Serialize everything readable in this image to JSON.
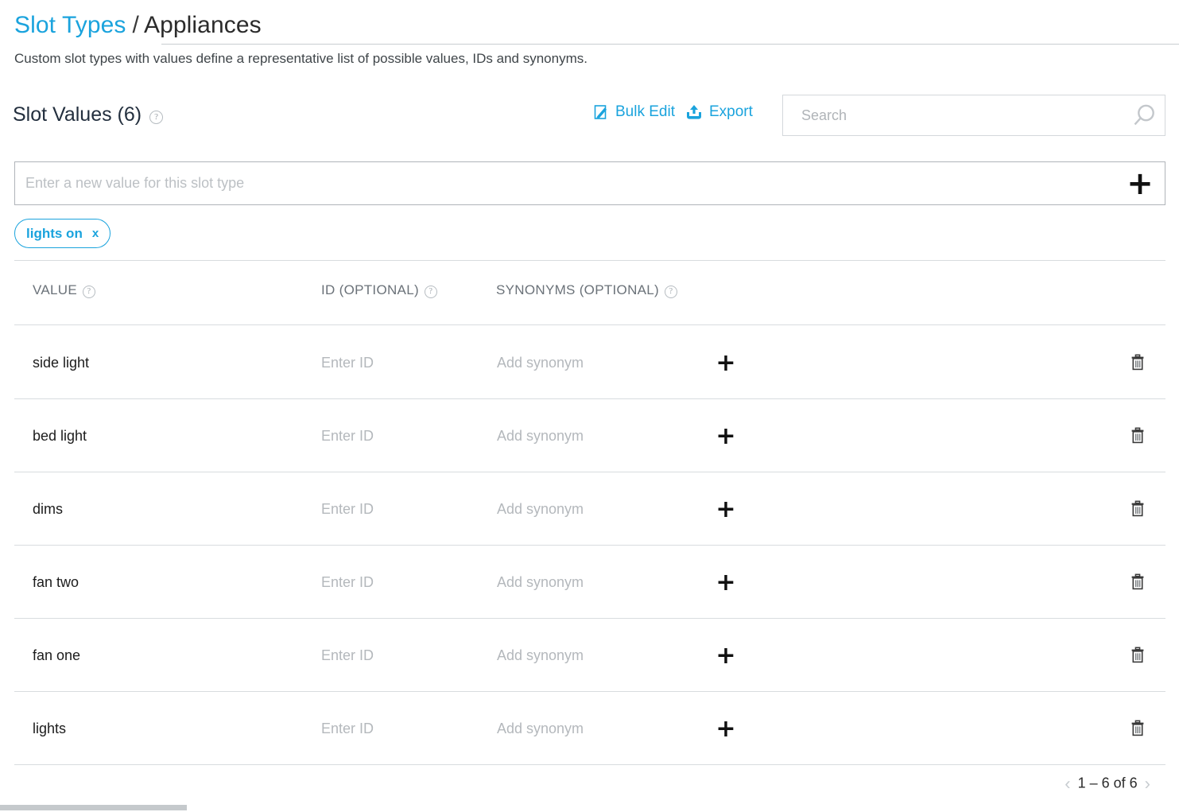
{
  "breadcrumb": {
    "parent": "Slot Types",
    "separator": "/",
    "current": "Appliances"
  },
  "subtitle": "Custom slot types with values define a representative list of possible values, IDs and synonyms.",
  "section": {
    "title": "Slot Values (6)",
    "help_glyph": "?"
  },
  "toolbar": {
    "bulk_edit_label": "Bulk Edit",
    "bulk_edit_icon": "bulk-edit-icon",
    "export_label": "Export",
    "export_icon": "export-upload-icon",
    "accent_color": "#1aa3dd"
  },
  "search": {
    "placeholder": "Search",
    "value": "",
    "icon": "search-icon"
  },
  "new_value": {
    "placeholder": "Enter a new value for this slot type",
    "value": "",
    "add_label": "+"
  },
  "chips": [
    {
      "label": "lights on",
      "remove_label": "x"
    }
  ],
  "table": {
    "columns": [
      {
        "label": "VALUE",
        "help": "?"
      },
      {
        "label": "ID (OPTIONAL)",
        "help": "?"
      },
      {
        "label": "SYNONYMS (OPTIONAL)",
        "help": "?"
      }
    ],
    "id_placeholder": "Enter ID",
    "synonym_placeholder": "Add synonym",
    "add_synonym_label": "+",
    "delete_icon": "trash-icon",
    "rows": [
      {
        "value": "side light",
        "id": "",
        "synonym": ""
      },
      {
        "value": "bed light",
        "id": "",
        "synonym": ""
      },
      {
        "value": "dims",
        "id": "",
        "synonym": ""
      },
      {
        "value": "fan two",
        "id": "",
        "synonym": ""
      },
      {
        "value": "fan one",
        "id": "",
        "synonym": ""
      },
      {
        "value": "lights",
        "id": "",
        "synonym": ""
      }
    ]
  },
  "pagination": {
    "prev_glyph": "‹",
    "label": "1 – 6 of 6",
    "next_glyph": "›"
  }
}
